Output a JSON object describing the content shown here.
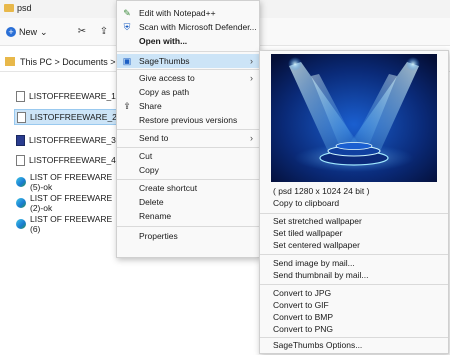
{
  "window": {
    "title": "psd"
  },
  "toolbar": {
    "new_label": "New",
    "new_chevron": "⌄"
  },
  "address": {
    "path": "This PC > Documents > A"
  },
  "files": [
    {
      "name": "LISTOFFREEWARE_1",
      "icon": "document-icon",
      "selected": false
    },
    {
      "name": "LISTOFFREEWARE_2",
      "icon": "document-icon",
      "selected": true
    },
    {
      "name": "LISTOFFREEWARE_3",
      "icon": "psd-image-icon",
      "selected": false
    },
    {
      "name": "LISTOFFREEWARE_4",
      "icon": "document-icon",
      "selected": false
    },
    {
      "name": "LIST OF FREEWARE (5)-ok",
      "icon": "edge-icon",
      "selected": false
    },
    {
      "name": "LIST OF FREEWARE (2)-ok",
      "icon": "edge-icon",
      "selected": false
    },
    {
      "name": "LIST OF FREEWARE (6)",
      "icon": "edge-icon",
      "selected": false
    }
  ],
  "context_menu": {
    "edit_notepad": "Edit with Notepad++",
    "scan_defender": "Scan with Microsoft Defender...",
    "open_with": "Open with...",
    "sagethumbs": "SageThumbs",
    "give_access": "Give access to",
    "copy_as_path": "Copy as path",
    "share": "Share",
    "restore_versions": "Restore previous versions",
    "send_to": "Send to",
    "cut": "Cut",
    "copy": "Copy",
    "create_shortcut": "Create shortcut",
    "delete": "Delete",
    "rename": "Rename",
    "properties": "Properties",
    "submenu_arrow": "›"
  },
  "sagethumbs_menu": {
    "image_info": "( psd 1280 x 1024 24 bit )",
    "copy_clipboard": "Copy to clipboard",
    "set_stretched": "Set stretched wallpaper",
    "set_tiled": "Set tiled wallpaper",
    "set_centered": "Set centered wallpaper",
    "send_image_mail": "Send image by mail...",
    "send_thumb_mail": "Send thumbnail by mail...",
    "convert_jpg": "Convert to JPG",
    "convert_gif": "Convert to GIF",
    "convert_bmp": "Convert to BMP",
    "convert_png": "Convert to PNG",
    "options": "SageThumbs Options..."
  },
  "colors": {
    "highlight": "#cce4f7",
    "stage_blue": "#0a3a8c",
    "light_cyan": "#9fe8ff"
  }
}
